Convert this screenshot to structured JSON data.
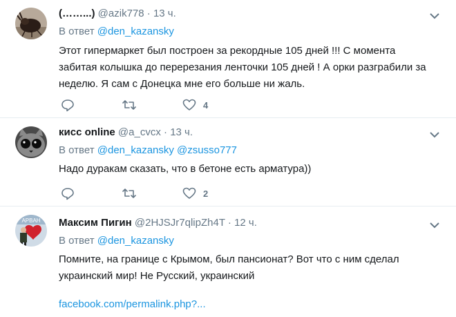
{
  "tweets": [
    {
      "name": "(……...)",
      "handle": "@azik778",
      "dot": "·",
      "time": "13 ч.",
      "reply_prefix": "В ответ",
      "mentions": [
        "@den_kazansky"
      ],
      "lines": [
        "Этот гипермаркет был построен за рекордные 105 дней !!! С момента",
        "забитая колышка до перерезания ленточки 105 дней ! А орки разграбили за",
        "неделю. Я сам с Донецка мне его больше ни жаль."
      ],
      "like_count": "4"
    },
    {
      "name": "кисс online",
      "handle": "@a_cvcx",
      "dot": "·",
      "time": "13 ч.",
      "reply_prefix": "В ответ",
      "mentions": [
        "@den_kazansky",
        "@zsusso777"
      ],
      "lines": [
        "Надо дуракам сказать, что в бетоне есть арматура))"
      ],
      "like_count": "2"
    },
    {
      "name": "Максим Пигин",
      "handle": "@2HJSJr7qlipZh4T",
      "dot": "·",
      "time": "12 ч.",
      "reply_prefix": "В ответ",
      "mentions": [
        "@den_kazansky"
      ],
      "lines": [
        "Помните, на границе с Крымом, был пансионат? Вот что с ним сделал",
        "украинский мир! Не Русский, украинский"
      ],
      "link": "facebook.com/permalink.php?..."
    }
  ],
  "icons": {
    "reply": "reply-icon",
    "retweet": "retweet-icon",
    "like": "heart-icon",
    "menu": "chevron-down-icon"
  },
  "colors": {
    "accent": "#1b95e0",
    "muted": "#657786",
    "divider": "#e6ecf0"
  }
}
